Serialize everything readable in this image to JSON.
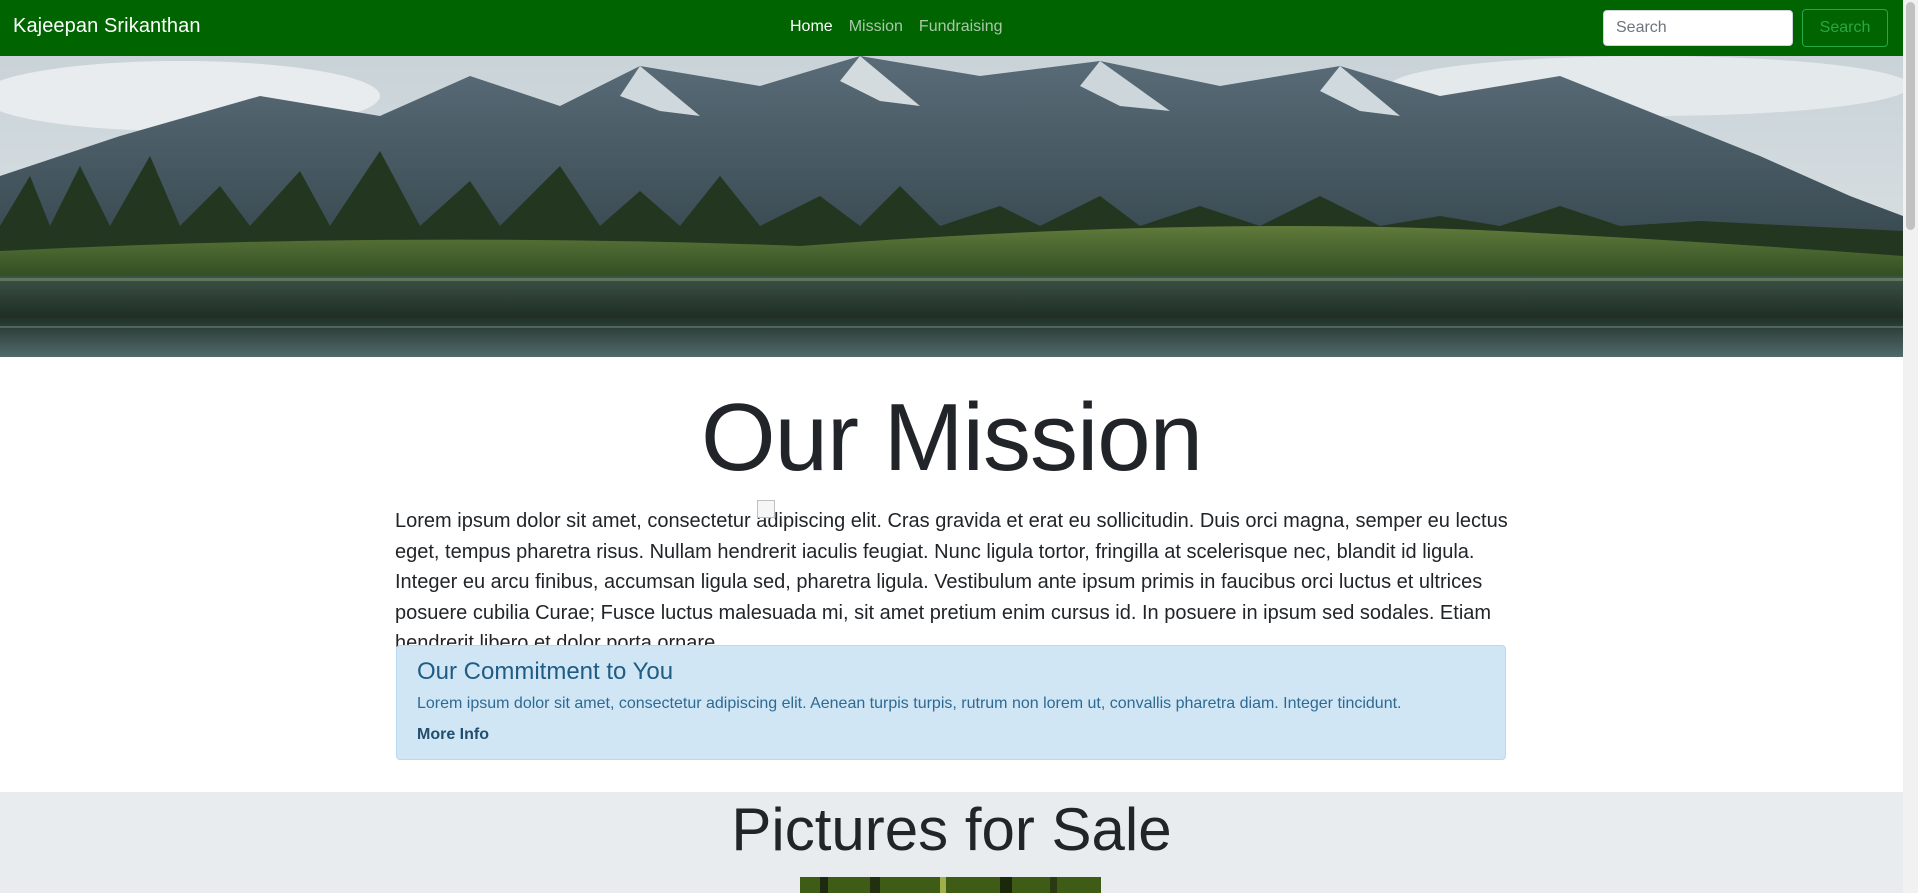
{
  "navbar": {
    "brand": "Kajeepan Srikanthan",
    "links": [
      {
        "label": "Home",
        "active": true
      },
      {
        "label": "Mission",
        "active": false
      },
      {
        "label": "Fundraising",
        "active": false
      }
    ],
    "search_placeholder": "Search",
    "search_button": "Search",
    "background_color": "#006400"
  },
  "mission": {
    "title": "Our Mission",
    "text_before_image": "Lorem ipsum dolor sit amet, consectetur a",
    "text_after_image": "dipiscing elit. Cras gravida et erat eu sollicitudin. Duis orci magna, semper eu lectus eget, tempus pharetra risus. Nullam hendrerit iaculis feugiat. Nunc ligula tortor, fringilla at scelerisque nec, blandit id ligula. Integer eu arcu finibus, accumsan ligula sed, pharetra ligula. Vestibulum ante ipsum primis in faucibus orci luctus et ultrices posuere cubilia Curae; Fusce luctus malesuada mi, sit amet pretium enim cursus id. In posuere in ipsum sed sodales. Etiam hendrerit libero et dolor porta ornare."
  },
  "commitment": {
    "heading": "Our Commitment to You",
    "text": "Lorem ipsum dolor sit amet, consectetur adipiscing elit. Aenean turpis turpis, rutrum non lorem ut, convallis pharetra diam. Integer tincidunt.",
    "link": "More Info",
    "background_color": "#d1e6f5"
  },
  "pictures": {
    "title": "Pictures for Sale"
  }
}
